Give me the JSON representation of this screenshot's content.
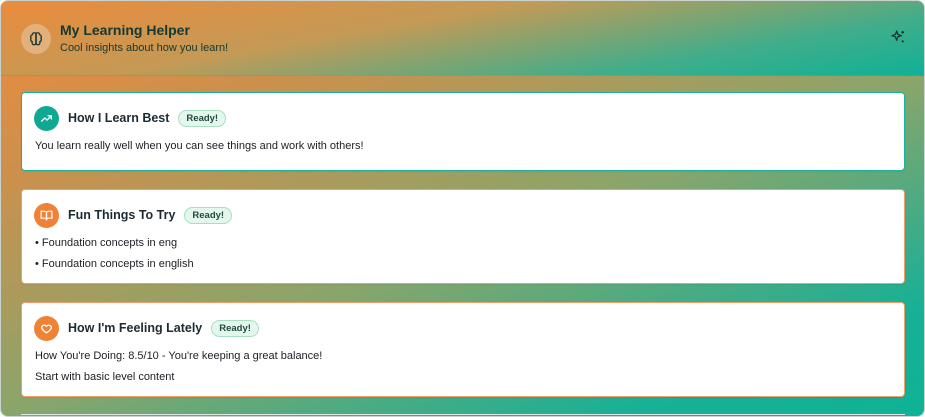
{
  "header": {
    "title": "My Learning Helper",
    "subtitle": "Cool insights about how you learn!",
    "logo_icon": "brain-icon",
    "action_icon": "sparkles-icon"
  },
  "cards": [
    {
      "title": "How I Learn Best",
      "badge": "Ready!",
      "icon": "trending-up-icon",
      "accent": "#0fa892",
      "lines": [
        "You learn really well when you can see things and work with others!"
      ]
    },
    {
      "title": "Fun Things To Try",
      "badge": "Ready!",
      "icon": "book-open-icon",
      "accent": "#f08236",
      "lines": [
        "• Foundation concepts in eng",
        "• Foundation concepts in english"
      ]
    },
    {
      "title": "How I'm Feeling Lately",
      "badge": "Ready!",
      "icon": "heart-icon",
      "accent": "#f08236",
      "lines": [
        "How You're Doing: 8.5/10 - You're keeping a great balance!",
        "Start with basic level content"
      ]
    }
  ]
}
